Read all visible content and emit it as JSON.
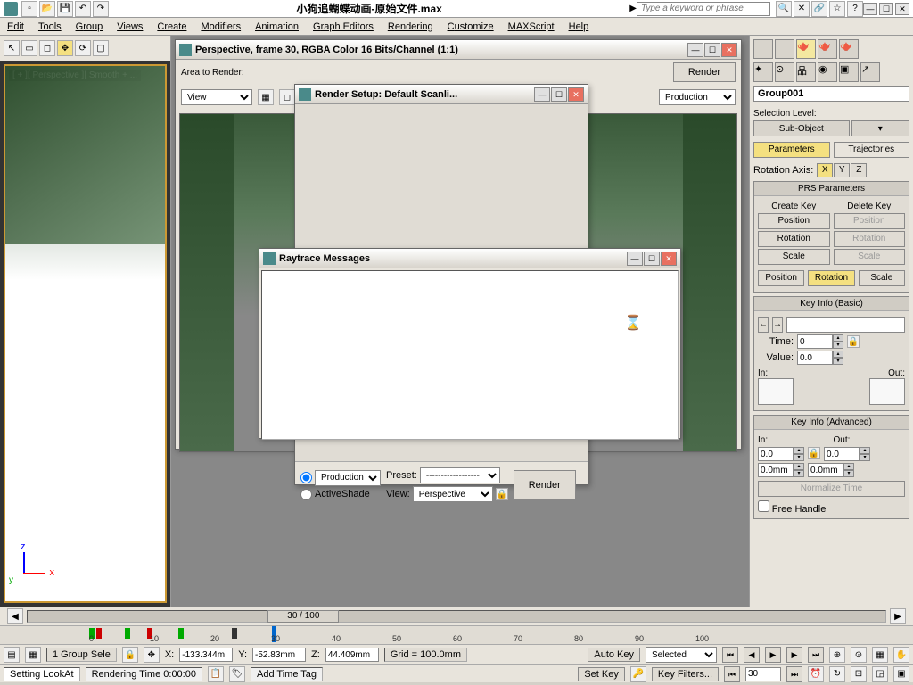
{
  "title": "小狗追蝴蝶动画-原始文件.max",
  "search_placeholder": "Type a keyword or phrase",
  "menus": [
    "Edit",
    "Tools",
    "Group",
    "Views",
    "Create",
    "Modifiers",
    "Animation",
    "Graph Editors",
    "Rendering",
    "Customize",
    "MAXScript",
    "Help"
  ],
  "render_frame": {
    "title": "Perspective, frame 30, RGBA Color 16 Bits/Channel (1:1)",
    "area_label": "Area to Render:",
    "area_value": "View",
    "render_btn": "Render",
    "prod_value": "Production"
  },
  "render_setup": {
    "title": "Render Setup: Default Scanli...",
    "production": "Production",
    "activeshade": "ActiveShade",
    "preset_label": "Preset:",
    "preset_value": "------------------",
    "view_label": "View:",
    "view_value": "Perspective",
    "render_btn": "Render"
  },
  "raytrace": {
    "title": "Raytrace Messages"
  },
  "viewport": {
    "label": "[ + ][ Perspective ][ Smooth + ..."
  },
  "right_panel": {
    "name": "Group001",
    "sel_level_label": "Selection Level:",
    "sub_object": "Sub-Object",
    "parameters": "Parameters",
    "trajectories": "Trajectories",
    "rotation_axis": "Rotation Axis:",
    "prs_header": "PRS Parameters",
    "create_key": "Create Key",
    "delete_key": "Delete Key",
    "position": "Position",
    "rotation": "Rotation",
    "scale": "Scale",
    "key_info_basic": "Key Info (Basic)",
    "time_label": "Time:",
    "time_value": "0",
    "value_label": "Value:",
    "value_value": "0.0",
    "in_label": "In:",
    "out_label": "Out:",
    "key_info_adv": "Key Info (Advanced)",
    "adv_in": "0.0",
    "adv_out": "0.0",
    "adv_in2": "0.0mm",
    "adv_out2": "0.0mm",
    "normalize": "Normalize Time",
    "free_handle": "Free Handle"
  },
  "timeline": {
    "slider_label": "30 / 100",
    "ticks": [
      "0",
      "10",
      "20",
      "30",
      "40",
      "50",
      "60",
      "70",
      "80",
      "90",
      "100"
    ]
  },
  "status": {
    "sel_info": "1 Group Sele",
    "x_label": "X:",
    "x": "-133.344m",
    "y_label": "Y:",
    "y": "-52.83mm",
    "z_label": "Z:",
    "z": "44.409mm",
    "grid": "Grid = 100.0mm",
    "auto_key": "Auto Key",
    "selected": "Selected",
    "set_key": "Set Key",
    "key_filters": "Key Filters...",
    "frame": "30",
    "add_time_tag": "Add Time Tag"
  },
  "bottom": {
    "setting": "Setting LookAt",
    "rendering": "Rendering Time 0:00:00"
  }
}
